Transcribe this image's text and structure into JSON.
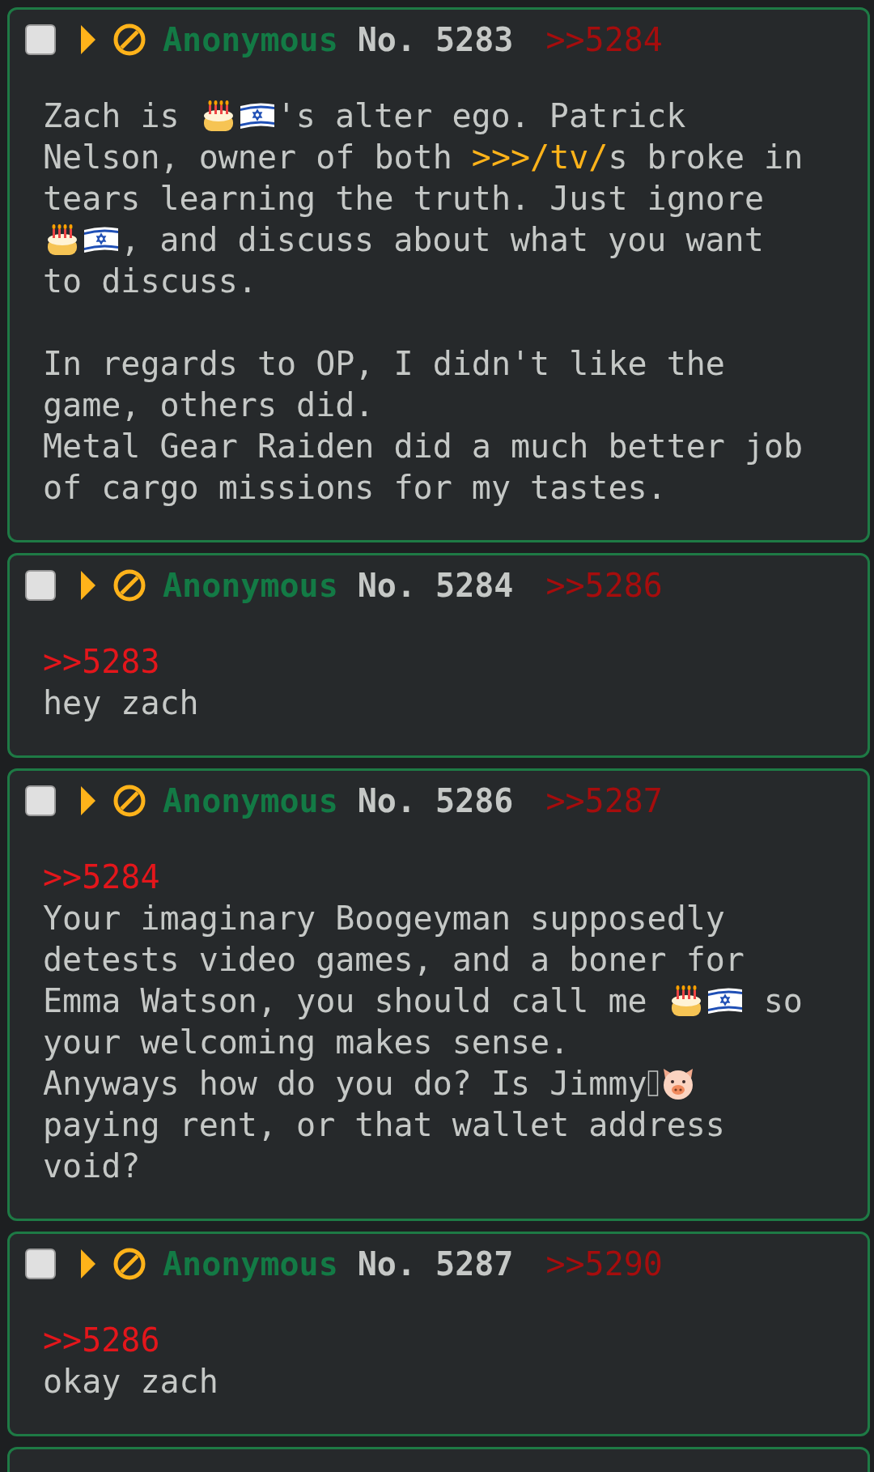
{
  "posts": [
    {
      "checked": false,
      "name": "Anonymous",
      "number": "No. 5283",
      "replies": [
        ">>5284"
      ],
      "paragraphs": [
        [
          [
            {
              "kind": "text",
              "text": "Zach is "
            },
            {
              "kind": "cake"
            },
            {
              "kind": "flag"
            },
            {
              "kind": "text",
              "text": "'s alter ego. Patrick"
            }
          ],
          [
            {
              "kind": "text",
              "text": "Nelson, owner of both "
            },
            {
              "kind": "board-link",
              "text": ">>>/tv/"
            },
            {
              "kind": "text",
              "text": "s broke in"
            }
          ],
          [
            {
              "kind": "text",
              "text": "tears learning the truth. Just ignore"
            }
          ],
          [
            {
              "kind": "cake"
            },
            {
              "kind": "flag"
            },
            {
              "kind": "text",
              "text": ", and discuss about what you want"
            }
          ],
          [
            {
              "kind": "text",
              "text": "to discuss."
            }
          ]
        ],
        [
          [
            {
              "kind": "text",
              "text": "In regards to OP, I didn't like the"
            }
          ],
          [
            {
              "kind": "text",
              "text": "game, others did."
            }
          ],
          [
            {
              "kind": "text",
              "text": "Metal Gear Raiden did a much better job"
            }
          ],
          [
            {
              "kind": "text",
              "text": "of cargo missions for my tastes."
            }
          ]
        ]
      ]
    },
    {
      "checked": false,
      "name": "Anonymous",
      "number": "No. 5284",
      "replies": [
        ">>5286"
      ],
      "paragraphs": [
        [
          [
            {
              "kind": "quote",
              "text": ">>5283"
            }
          ],
          [
            {
              "kind": "text",
              "text": "hey zach"
            }
          ]
        ]
      ]
    },
    {
      "checked": false,
      "name": "Anonymous",
      "number": "No. 5286",
      "replies": [
        ">>5287"
      ],
      "paragraphs": [
        [
          [
            {
              "kind": "quote",
              "text": ">>5284"
            }
          ],
          [
            {
              "kind": "text",
              "text": "Your imaginary Boogeyman supposedly"
            }
          ],
          [
            {
              "kind": "text",
              "text": "detests video games, and a boner for"
            }
          ],
          [
            {
              "kind": "text",
              "text": "Emma Watson, you should call me "
            },
            {
              "kind": "cake"
            },
            {
              "kind": "flag"
            },
            {
              "kind": "text",
              "text": " so"
            }
          ],
          [
            {
              "kind": "text",
              "text": "your welcoming makes sense."
            }
          ],
          [
            {
              "kind": "text",
              "text": "Anyways how do you do? Is Jimmy"
            },
            {
              "kind": "tofu"
            },
            {
              "kind": "pig"
            }
          ],
          [
            {
              "kind": "text",
              "text": "paying rent, or that wallet address"
            }
          ],
          [
            {
              "kind": "text",
              "text": "void?"
            }
          ]
        ]
      ]
    },
    {
      "checked": false,
      "name": "Anonymous",
      "number": "No. 5287",
      "replies": [
        ">>5290"
      ],
      "paragraphs": [
        [
          [
            {
              "kind": "quote",
              "text": ">>5286"
            }
          ],
          [
            {
              "kind": "text",
              "text": "okay zach"
            }
          ]
        ]
      ]
    }
  ]
}
